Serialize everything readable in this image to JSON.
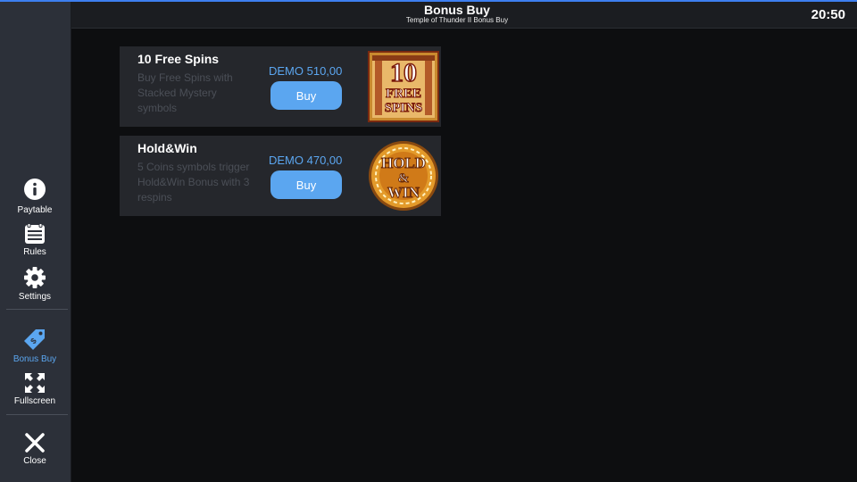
{
  "header": {
    "title": "Bonus Buy",
    "subtitle": "Temple of Thunder II Bonus Buy",
    "clock": "20:50"
  },
  "sidebar": {
    "items": [
      {
        "label": "Paytable",
        "icon": "info-icon"
      },
      {
        "label": "Rules",
        "icon": "rules-icon"
      },
      {
        "label": "Settings",
        "icon": "gear-icon"
      },
      {
        "label": "Bonus Buy",
        "icon": "tag-icon",
        "active": true
      },
      {
        "label": "Fullscreen",
        "icon": "fullscreen-icon"
      },
      {
        "label": "Close",
        "icon": "close-icon"
      }
    ]
  },
  "offers": [
    {
      "name": "10 Free Spins",
      "description": "Buy Free Spins with Stacked Mystery symbols",
      "price": "DEMO 510,00",
      "buy_label": "Buy",
      "art_text": [
        "10",
        "FREE",
        "SPINS"
      ]
    },
    {
      "name": "Hold&Win",
      "description": "5 Coins symbols trigger Hold&Win Bonus with 3 respins",
      "price": "DEMO 470,00",
      "buy_label": "Buy",
      "art_text": [
        "HOLD",
        "&",
        "WIN"
      ]
    }
  ],
  "colors": {
    "accent": "#5ba6f0",
    "topline": "#3d7ff0",
    "sidebar": "#2c3039",
    "card": "#25272c",
    "background": "#0d0e10"
  }
}
